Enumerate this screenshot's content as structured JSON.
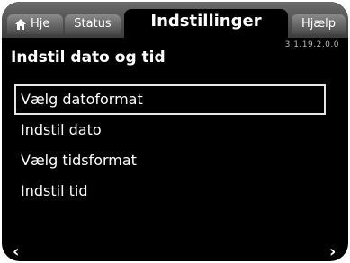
{
  "header": {
    "home_label": "Hje",
    "status_label": "Status",
    "active_tab_label": "Indstillinger",
    "help_label": "Hjælp",
    "version": "3.1.19.2.0.0"
  },
  "page": {
    "title": "Indstil dato og tid"
  },
  "menu": {
    "items": [
      {
        "label": "Vælg datoformat",
        "selected": true
      },
      {
        "label": "Indstil dato",
        "selected": false
      },
      {
        "label": "Vælg tidsformat",
        "selected": false
      },
      {
        "label": "Indstil tid",
        "selected": false
      }
    ]
  },
  "footer": {
    "back_icon": "chevron-left-icon",
    "forward_icon": "chevron-right-icon"
  }
}
